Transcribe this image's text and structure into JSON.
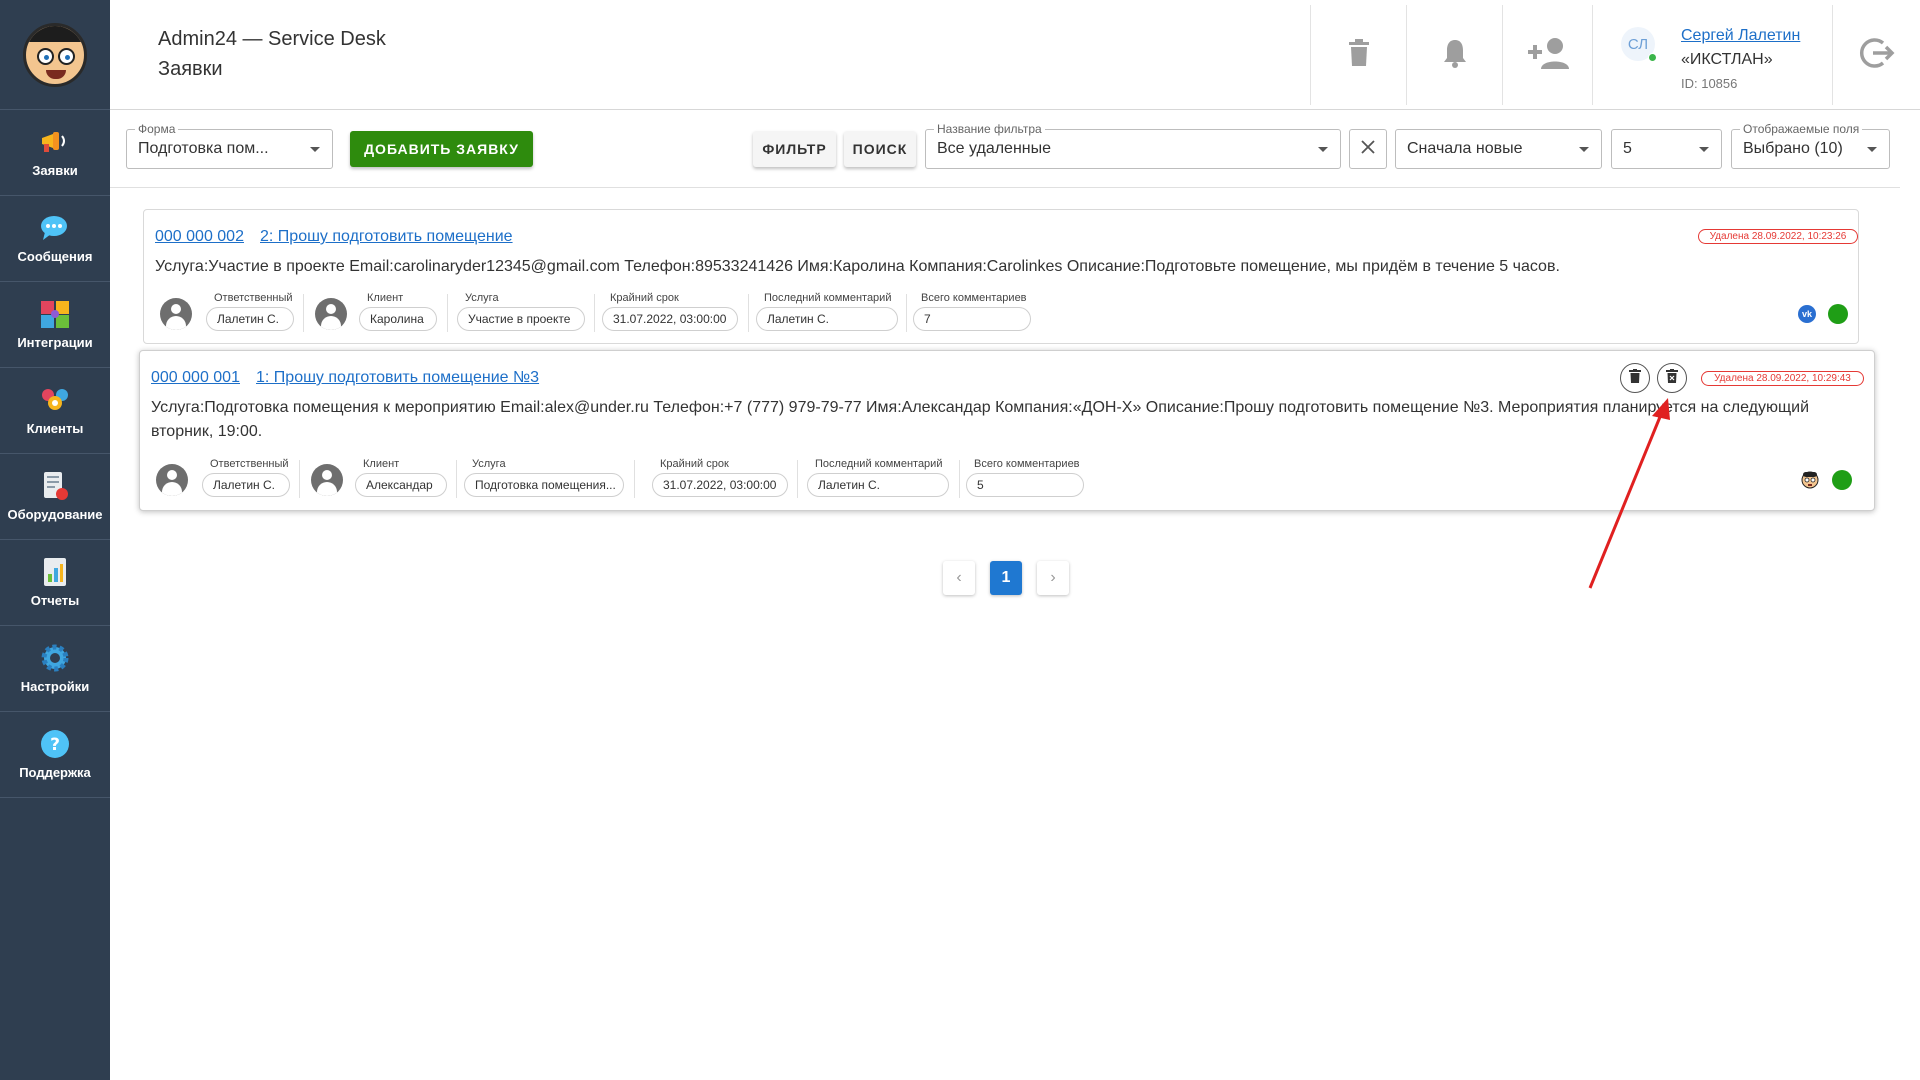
{
  "sidebar": {
    "items": [
      {
        "label": "Заявки",
        "icon": "megaphone-icon"
      },
      {
        "label": "Сообщения",
        "icon": "chat-icon"
      },
      {
        "label": "Интеграции",
        "icon": "puzzle-icon"
      },
      {
        "label": "Клиенты",
        "icon": "clients-icon"
      },
      {
        "label": "Оборудование",
        "icon": "equipment-icon"
      },
      {
        "label": "Отчеты",
        "icon": "report-icon"
      },
      {
        "label": "Настройки",
        "icon": "gear-icon"
      },
      {
        "label": "Поддержка",
        "icon": "help-icon"
      }
    ]
  },
  "header": {
    "app_title": "Admin24 — Service Desk",
    "page_title": "Заявки",
    "user": {
      "initials": "СЛ",
      "name": "Сергей Лалетин",
      "company": "«ИКСТЛАН»",
      "id": "ID: 10856"
    }
  },
  "toolbar": {
    "form_label": "Форма",
    "form_value": "Подготовка пом...",
    "add_label": "ДОБАВИТЬ ЗАЯВКУ",
    "filter_label": "ФИЛЬТР",
    "search_label": "ПОИСК",
    "filter_name_label": "Название фильтра",
    "filter_name_value": "Все удаленные",
    "sort_value": "Сначала новые",
    "per_page_value": "5",
    "fields_label": "Отображаемые поля",
    "fields_value": "Выбрано (10)"
  },
  "meta_labels": {
    "responsible": "Ответственный",
    "client": "Клиент",
    "service": "Услуга",
    "deadline": "Крайний срок",
    "last_comment": "Последний комментарий",
    "total_comments": "Всего комментариев"
  },
  "tickets": [
    {
      "number": "000 000 002",
      "title": "2: Прошу подготовить помещение",
      "deleted": "Удалена 28.09.2022, 10:23:26",
      "description": "Услуга:Участие в проекте Email:carolinaryder12345@gmail.com Телефон:89533241426 Имя:Каролина Компания:Carolinkes Описание:Подготовьте помещение, мы придём в течение 5 часов.",
      "responsible": "Лалетин С.",
      "client": "Каролина",
      "service": "Участие в проекте",
      "deadline": "31.07.2022, 03:00:00",
      "last_comment": "Лалетин С.",
      "total_comments": "7",
      "channel": "vk",
      "status_color": "#1f9e16"
    },
    {
      "number": "000 000 001",
      "title": "1: Прошу подготовить помещение №3",
      "deleted": "Удалена 28.09.2022, 10:29:43",
      "description": "Услуга:Подготовка помещения к мероприятию Email:alex@under.ru Телефон:+7 (777) 979-79-77 Имя:Александар Компания:«ДОН-Х» Описание:Прошу подготовить помещение №3. Мероприятия планируется на следующий вторник, 19:00.",
      "responsible": "Лалетин С.",
      "client": "Александар",
      "service": "Подготовка помещения...",
      "deadline": "31.07.2022, 03:00:00",
      "last_comment": "Лалетин С.",
      "total_comments": "5",
      "channel": "avatar",
      "status_color": "#1f9e16"
    }
  ],
  "pagination": {
    "current": "1",
    "prev": "‹",
    "next": "›"
  },
  "colors": {
    "sidebar": "#2f3e50",
    "accent": "#1d6fc8",
    "add_button": "#2e8b0d",
    "deleted": "#e53935",
    "annotation_arrow": "#e02020"
  }
}
